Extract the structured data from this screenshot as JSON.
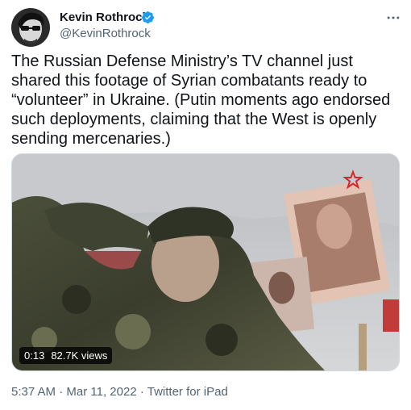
{
  "author": {
    "name": "Kevin Rothrock",
    "handle": "@KevinRothrock",
    "verified": true
  },
  "tweet": {
    "text": "The Russian Defense Ministry’s TV channel just shared this footage of Syrian combatants ready to “volunteer” in Ukraine. (Putin moments ago endorsed such deployments, claiming that the West is openly sending mercenaries.)"
  },
  "video": {
    "duration": "0:13",
    "views": "82.7K views"
  },
  "meta": {
    "time": "5:37 AM",
    "date": "Mar 11, 2022",
    "source": "Twitter for iPad",
    "separator": "·"
  },
  "colors": {
    "text": "#0f1419",
    "secondary": "#536471",
    "verified": "#1d9bf0"
  },
  "icons": {
    "verified": "verified-badge-icon",
    "more": "more-horizontal-icon",
    "watermark": "red-star-icon"
  }
}
